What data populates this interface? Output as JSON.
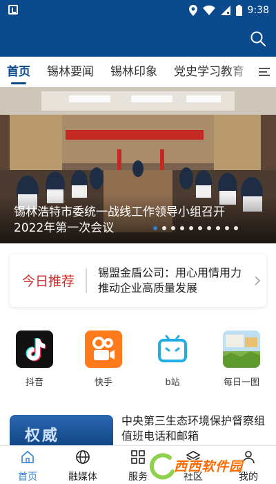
{
  "status_bar": {
    "time": "9:38"
  },
  "tabs": [
    {
      "label": "首页"
    },
    {
      "label": "锡林要闻"
    },
    {
      "label": "锡林印象"
    },
    {
      "label": "党史学习教育"
    }
  ],
  "banner": {
    "caption": "锡林浩特市委统一战线工作领导小组召开2022年第一次会议",
    "slide_count": 10,
    "active_slide": 1
  },
  "recommend": {
    "tag": "今日推荐",
    "text": "锡盟金盾公司：用心用情用力推动企业高质量发展"
  },
  "apps": [
    {
      "label": "抖音",
      "icon": "douyin-icon"
    },
    {
      "label": "快手",
      "icon": "kuaishou-icon"
    },
    {
      "label": "b站",
      "icon": "bilibili-icon"
    },
    {
      "label": "每日一图",
      "icon": "daily-photo-icon"
    }
  ],
  "news": {
    "thumb_text": "权威",
    "title": "中央第三生态环境保护督察组值班电话和邮箱"
  },
  "bottom_nav": [
    {
      "label": "首页",
      "icon": "home-icon"
    },
    {
      "label": "融媒体",
      "icon": "globe-icon"
    },
    {
      "label": "服务",
      "icon": "grid-icon"
    },
    {
      "label": "社区",
      "icon": "layers-icon"
    },
    {
      "label": "我的",
      "icon": "user-icon"
    }
  ],
  "watermark": {
    "text": "西西软件园"
  },
  "colors": {
    "brand_blue": "#0a4a8d",
    "accent_blue": "#2f80d6",
    "recommend_red": "#d62b2b",
    "kuaishou_orange": "#ff7a1a",
    "bilibili_blue": "#23ade5"
  }
}
